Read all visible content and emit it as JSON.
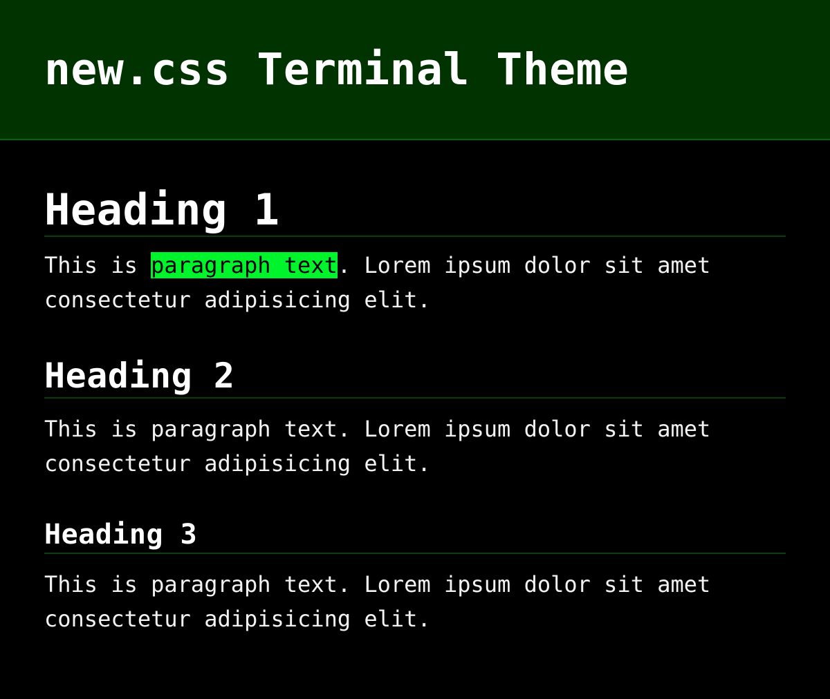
{
  "header": {
    "title": "new.css Terminal Theme"
  },
  "theme": {
    "page_background": "#000000",
    "header_background": "#013301",
    "header_border": "#046604",
    "heading_underline": "#0b3d0b",
    "text_color": "#f2f2f2",
    "heading_color": "#ffffff",
    "mark_background": "#00f42b",
    "mark_color": "#000000"
  },
  "main": {
    "sections": [
      {
        "heading": "Heading 1",
        "paragraph": {
          "before": "This is ",
          "highlight": "paragraph text",
          "after": ". Lorem ipsum dolor sit amet consectetur adipisicing elit."
        }
      },
      {
        "heading": "Heading 2",
        "paragraph": {
          "full": "This is paragraph text. Lorem ipsum dolor sit amet consectetur adipisicing elit."
        }
      },
      {
        "heading": "Heading 3",
        "paragraph": {
          "full": "This is paragraph text. Lorem ipsum dolor sit amet consectetur adipisicing elit."
        }
      }
    ]
  }
}
